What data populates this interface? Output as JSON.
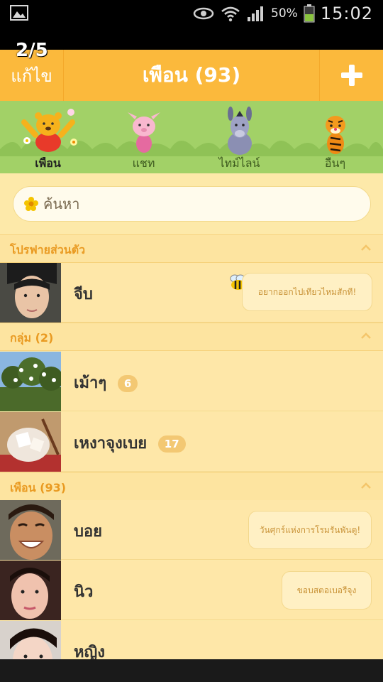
{
  "status_bar": {
    "battery_pct": "50%",
    "time": "15:02"
  },
  "page_indicator": "2/5",
  "header": {
    "edit_label": "แก้ไข",
    "title": "เพือน (93)"
  },
  "tabs": [
    {
      "label": "เพือน",
      "icon": "pooh-icon",
      "active": true
    },
    {
      "label": "แชท",
      "icon": "piglet-icon",
      "active": false
    },
    {
      "label": "ไทม์ไลน์",
      "icon": "eeyore-icon",
      "active": false
    },
    {
      "label": "อืนๆ",
      "icon": "tigger-icon",
      "active": false
    }
  ],
  "search": {
    "placeholder": "ค้นหา"
  },
  "sections": {
    "profile": "โปรฟายส่วนตัว",
    "groups": "กลุ่ม (2)",
    "friends": "เพือน (93)"
  },
  "profile": {
    "name": "จีบ",
    "status": "อยากออกไปเทียวไหมสักที!"
  },
  "groups": [
    {
      "name": "เม้าๆ",
      "count": "6"
    },
    {
      "name": "เหงาจุงเบย",
      "count": "17"
    }
  ],
  "friends": [
    {
      "name": "บอย",
      "status": "วันศุกร์แห่งการโรมรันพันตู!"
    },
    {
      "name": "นิว",
      "status": "ขอบสตอเบอรีจุง"
    },
    {
      "name": "หญิง",
      "status": ""
    }
  ],
  "colors": {
    "header": "#fbb93c",
    "tabs": "#a2d167",
    "list_bg": "#fee7a8",
    "section_text": "#e99a21"
  }
}
